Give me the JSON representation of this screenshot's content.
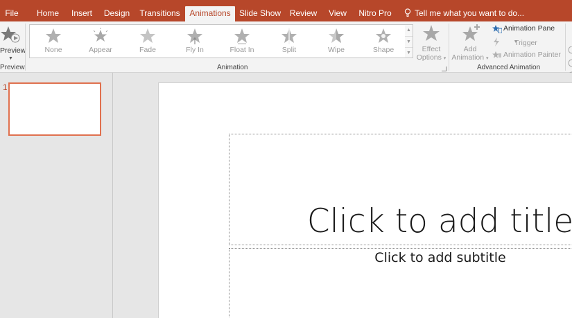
{
  "tabs": [
    {
      "label": "File",
      "active": false
    },
    {
      "label": "Home",
      "active": false
    },
    {
      "label": "Insert",
      "active": false
    },
    {
      "label": "Design",
      "active": false
    },
    {
      "label": "Transitions",
      "active": false
    },
    {
      "label": "Animations",
      "active": true
    },
    {
      "label": "Slide Show",
      "active": false
    },
    {
      "label": "Review",
      "active": false
    },
    {
      "label": "View",
      "active": false
    },
    {
      "label": "Nitro Pro",
      "active": false
    }
  ],
  "tell_me": "Tell me what you want to do...",
  "preview_group": {
    "button_label": "Preview",
    "group_label": "Preview"
  },
  "animation_group": {
    "group_label": "Animation",
    "gallery": [
      {
        "label": "None",
        "icon": "star-none-icon"
      },
      {
        "label": "Appear",
        "icon": "star-appear-icon"
      },
      {
        "label": "Fade",
        "icon": "star-fade-icon"
      },
      {
        "label": "Fly In",
        "icon": "star-fly-in-icon"
      },
      {
        "label": "Float In",
        "icon": "star-float-in-icon"
      },
      {
        "label": "Split",
        "icon": "star-split-icon"
      },
      {
        "label": "Wipe",
        "icon": "star-wipe-icon"
      },
      {
        "label": "Shape",
        "icon": "star-shape-icon"
      }
    ],
    "effect_options": {
      "line1": "Effect",
      "line2": "Options"
    }
  },
  "advanced_group": {
    "group_label": "Advanced Animation",
    "add_animation": {
      "line1": "Add",
      "line2": "Animation"
    },
    "animation_pane": "Animation Pane",
    "trigger": "Trigger",
    "animation_painter": "Animation Painter"
  },
  "slides": [
    {
      "number": "1"
    }
  ],
  "slide": {
    "title_placeholder": "Click to add title",
    "subtitle_placeholder": "Click to add subtitle"
  },
  "colors": {
    "accent": "#b7472a",
    "ribbon": "#f3f3f3",
    "thumb_border": "#e0704e"
  }
}
